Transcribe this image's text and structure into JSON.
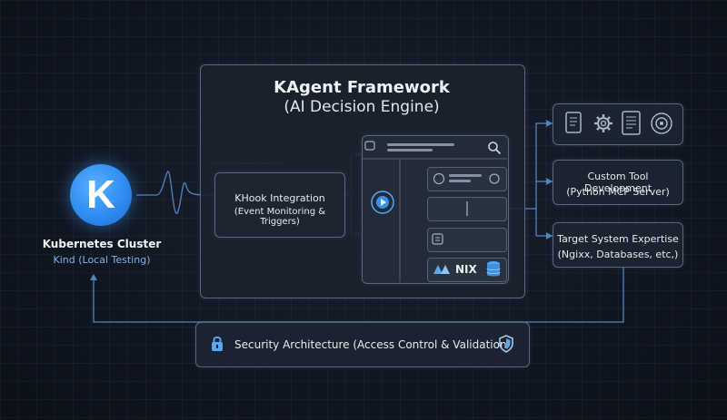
{
  "framework": {
    "title": "KAgent Framework",
    "subtitle": "(AI Decision Engine)"
  },
  "khook": {
    "title": "KHook Integration",
    "subtitle": "(Event Monitoring & Triggers)"
  },
  "cluster": {
    "logo_letter": "K",
    "title": "Kubernetes Cluster",
    "subtitle": "Kind (Local Testing)"
  },
  "tools": {
    "title": "Custom Tool Development",
    "subtitle": "(Python MCP Server)"
  },
  "target": {
    "title": "Target System Expertise",
    "subtitle": "(Ngixx, Databases, etc,)"
  },
  "security": {
    "label": "Security Architecture (Access Control & Validation"
  },
  "nix": {
    "label": "NIX"
  },
  "colors": {
    "accent": "#4a9ff5",
    "wire": "#4f86c0",
    "background": "#111722"
  },
  "icons": [
    "document-icon",
    "gear-icon",
    "checklist-icon",
    "target-icon",
    "lock-icon",
    "shield-icon",
    "search-icon",
    "play-icon",
    "database-icon"
  ]
}
